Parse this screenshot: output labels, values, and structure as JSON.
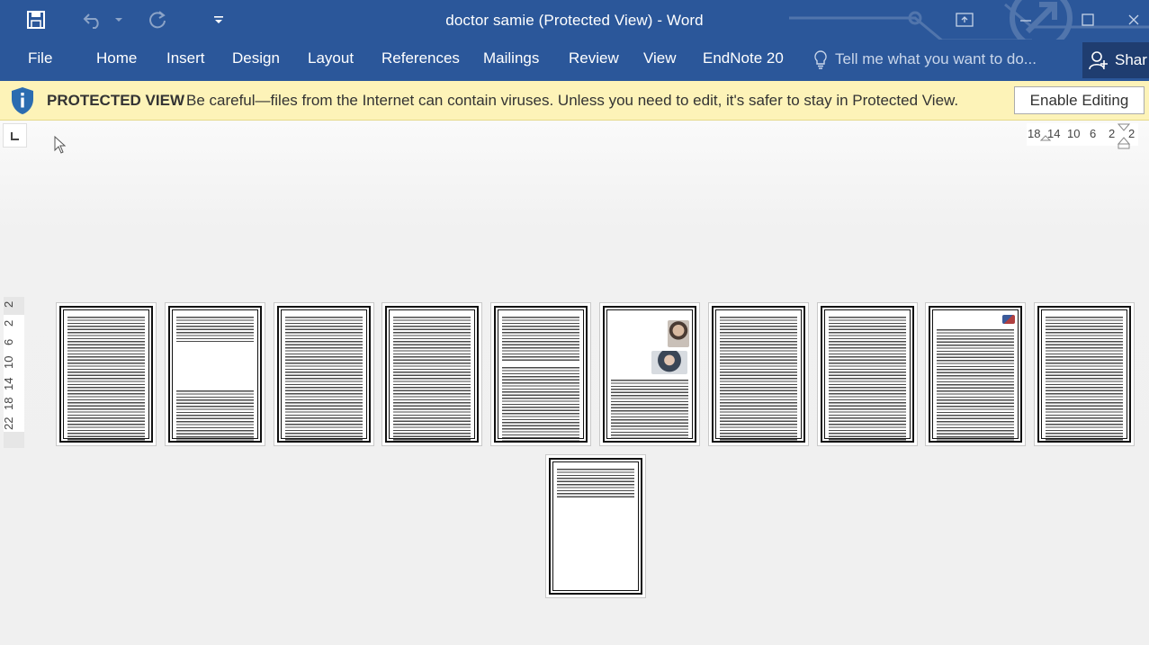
{
  "window": {
    "title": "doctor samie (Protected View) - Word"
  },
  "quick_access": {
    "icons": [
      "save-icon",
      "undo-icon",
      "dropdown-icon",
      "redo-icon",
      "customize-icon"
    ]
  },
  "ribbon": {
    "tabs": [
      {
        "label": "File"
      },
      {
        "label": "Home"
      },
      {
        "label": "Insert"
      },
      {
        "label": "Design"
      },
      {
        "label": "Layout"
      },
      {
        "label": "References"
      },
      {
        "label": "Mailings"
      },
      {
        "label": "Review"
      },
      {
        "label": "View"
      },
      {
        "label": "EndNote 20"
      }
    ],
    "tell_me_placeholder": "Tell me what you want to do...",
    "share_label": "Shar"
  },
  "protected_view": {
    "title": "PROTECTED VIEW",
    "message": "Be careful—files from the Internet can contain viruses. Unless you need to edit, it's safer to stay in Protected View.",
    "enable_button": "Enable Editing"
  },
  "rulers": {
    "horizontal_labels": [
      "18",
      "14",
      "10",
      "6",
      "2",
      "2"
    ],
    "vertical_labels": [
      "2",
      "2",
      "6",
      "10",
      "14",
      "18",
      "22"
    ]
  },
  "document": {
    "page_count": 11,
    "colors": {
      "ribbon": "#2b579a",
      "protected_bar": "#fdf3b8",
      "canvas": "#f0f0f0"
    }
  }
}
